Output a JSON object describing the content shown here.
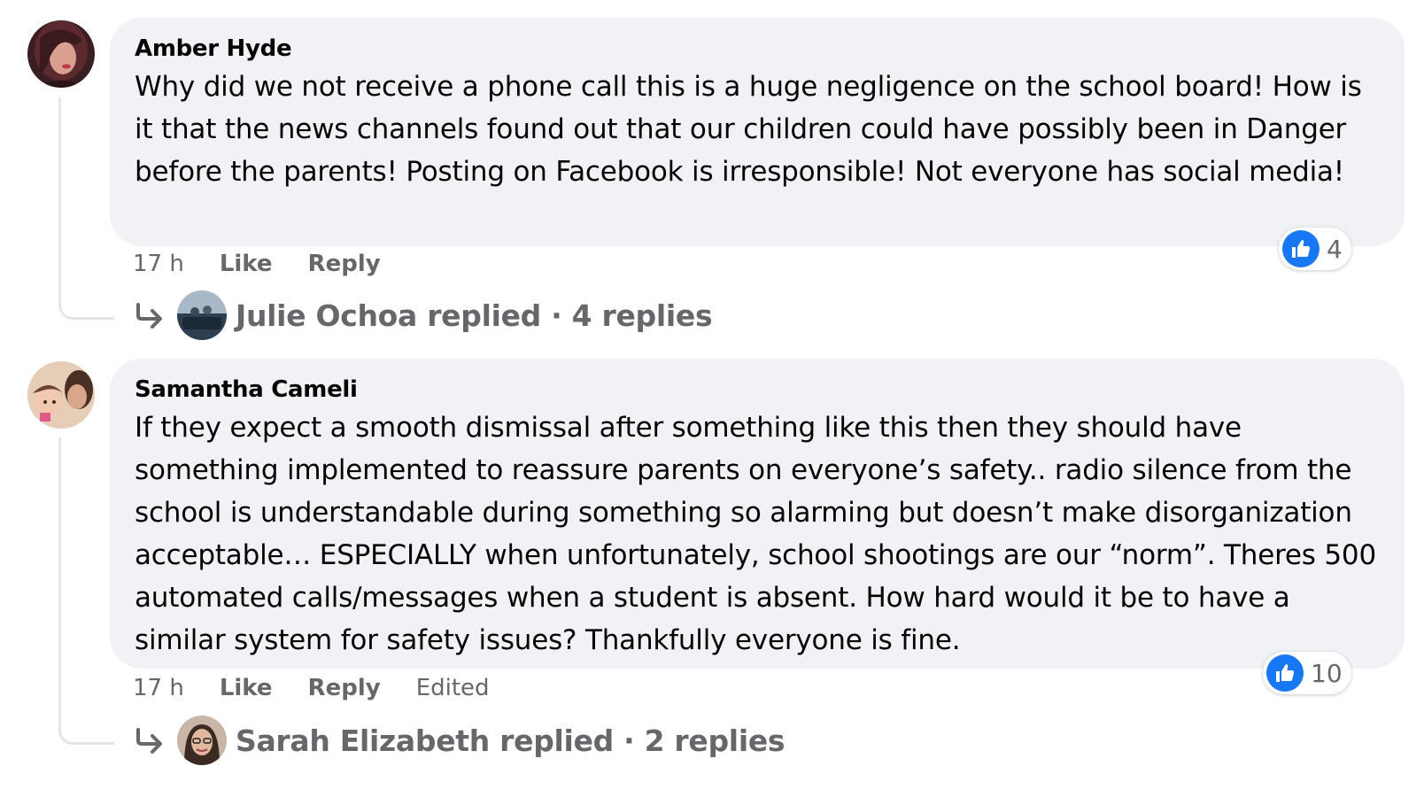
{
  "colors": {
    "bubble_bg": "#f0f2f5",
    "secondary_text": "#65676b",
    "like_blue": "#1877f2",
    "thread_line": "#e4e6eb"
  },
  "comments": [
    {
      "author": "Amber Hyde",
      "text": "Why did we not receive a phone call this is a huge negligence on the school board! How is it that the news channels found out that our children could have possibly been in Danger before the parents! Posting on Facebook is irresponsible! Not everyone has social media!",
      "time": "17 h",
      "like_label": "Like",
      "reply_label": "Reply",
      "reaction_icon": "thumbs-up-icon",
      "reaction_count": "4",
      "replies_summary": "Julie Ochoa replied · 4 replies"
    },
    {
      "author": "Samantha Cameli",
      "text": "If they expect a smooth dismissal after something like this then they should have something implemented to reassure parents on everyone’s safety.. radio silence from the school is understandable during something so alarming but doesn’t make disorganization acceptable… ESPECIALLY when unfortunately, school shootings are our “norm”. Theres 500 automated calls/messages when a student is absent. How hard would it be to have a similar system for safety issues? Thankfully everyone is fine.",
      "time": "17 h",
      "like_label": "Like",
      "reply_label": "Reply",
      "edited_label": "Edited",
      "reaction_icon": "thumbs-up-icon",
      "reaction_count": "10",
      "replies_summary": "Sarah Elizabeth replied · 2 replies"
    }
  ]
}
